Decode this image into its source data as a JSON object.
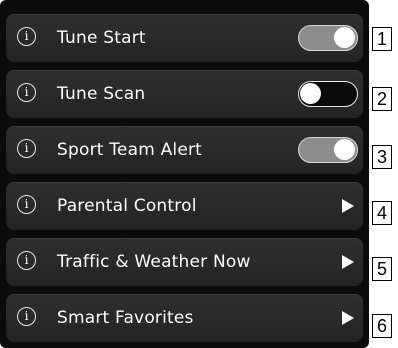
{
  "items": [
    {
      "label": "Tune Start",
      "control": "toggle",
      "state": "on",
      "callout": "1"
    },
    {
      "label": "Tune Scan",
      "control": "toggle",
      "state": "off",
      "callout": "2"
    },
    {
      "label": "Sport Team Alert",
      "control": "toggle",
      "state": "on",
      "callout": "3"
    },
    {
      "label": "Parental Control",
      "control": "arrow",
      "callout": "4"
    },
    {
      "label": "Traffic & Weather Now",
      "control": "arrow",
      "callout": "5"
    },
    {
      "label": "Smart Favorites",
      "control": "arrow",
      "callout": "6"
    }
  ],
  "info_icon_glyph": "i",
  "icons": {
    "info": "info-icon",
    "arrow": "chevron-right-icon"
  },
  "colors": {
    "panel_background": "#0b0b0b",
    "row_background": "#2b2b2b",
    "text": "#ffffff",
    "toggle_on_track": "#8d8d8d"
  }
}
